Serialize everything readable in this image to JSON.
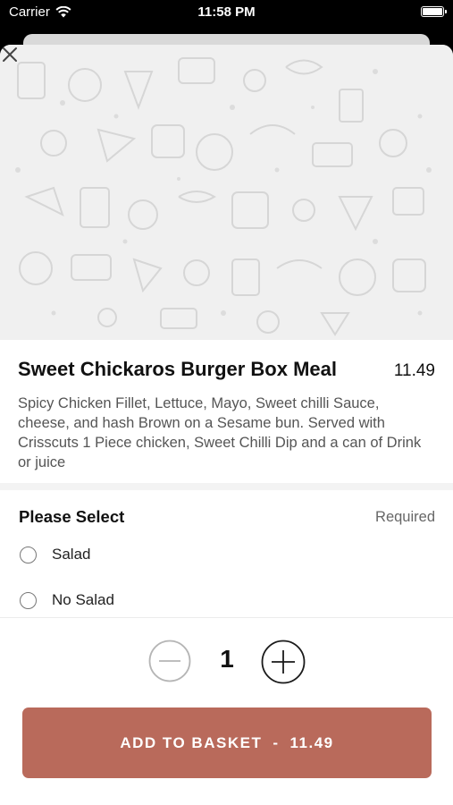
{
  "status_bar": {
    "carrier": "Carrier",
    "time": "11:58 PM"
  },
  "item": {
    "title": "Sweet Chickaros Burger Box Meal",
    "price": "11.49",
    "description": "Spicy Chicken Fillet, Lettuce, Mayo, Sweet chilli Sauce, cheese, and hash Brown on a Sesame bun. Served with Crisscuts 1 Piece chicken, Sweet Chilli Dip and a can of Drink or juice"
  },
  "selection": {
    "title": "Please Select",
    "required_label": "Required",
    "options": [
      {
        "label": "Salad"
      },
      {
        "label": "No Salad"
      }
    ]
  },
  "quantity": {
    "value": "1"
  },
  "add_button": {
    "label": "ADD TO BASKET",
    "separator": "-",
    "price": "11.49"
  },
  "colors": {
    "accent": "#b96a5b",
    "hero_bg": "#f0f0f0"
  },
  "icons": {
    "close": "close-icon",
    "minus": "minus-icon",
    "plus": "plus-icon",
    "wifi": "wifi-icon",
    "battery": "battery-icon"
  }
}
